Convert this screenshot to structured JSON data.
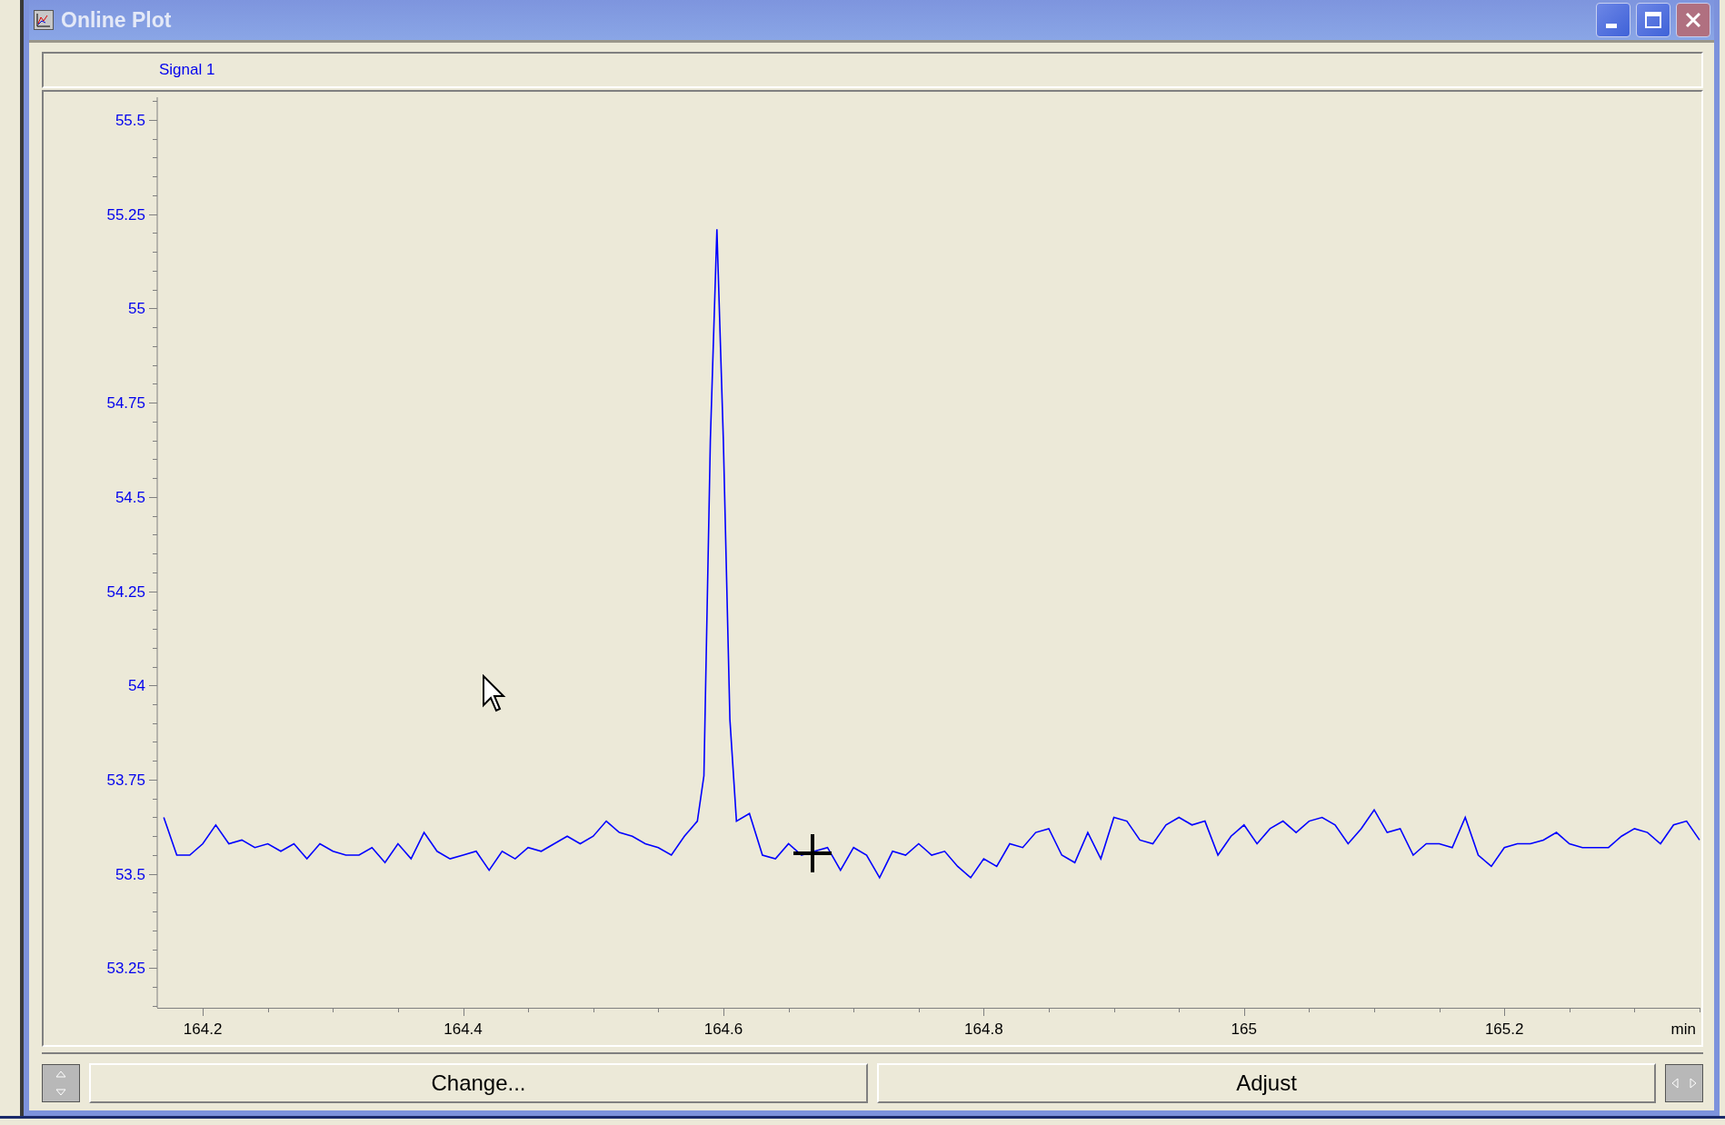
{
  "window": {
    "title": "Online Plot"
  },
  "plot": {
    "chart_data": {
      "type": "line",
      "xlabel": "min",
      "xlim": [
        164.165,
        165.35
      ],
      "ylim": [
        53.145,
        55.56
      ],
      "xticks": [
        164.2,
        164.4,
        164.6,
        164.8,
        165,
        165.2
      ],
      "yticks": [
        53.25,
        53.5,
        53.75,
        54,
        54.25,
        54.5,
        54.75,
        55,
        55.25,
        55.5
      ],
      "x": [
        164.17,
        164.18,
        164.19,
        164.2,
        164.21,
        164.22,
        164.23,
        164.24,
        164.25,
        164.26,
        164.27,
        164.28,
        164.29,
        164.3,
        164.31,
        164.32,
        164.33,
        164.34,
        164.35,
        164.36,
        164.37,
        164.38,
        164.39,
        164.4,
        164.41,
        164.42,
        164.43,
        164.44,
        164.45,
        164.46,
        164.47,
        164.48,
        164.49,
        164.5,
        164.51,
        164.52,
        164.53,
        164.54,
        164.55,
        164.56,
        164.57,
        164.58,
        164.585,
        164.59,
        164.595,
        164.6,
        164.605,
        164.61,
        164.62,
        164.63,
        164.64,
        164.65,
        164.66,
        164.67,
        164.68,
        164.69,
        164.7,
        164.71,
        164.72,
        164.73,
        164.74,
        164.75,
        164.76,
        164.77,
        164.78,
        164.79,
        164.8,
        164.81,
        164.82,
        164.83,
        164.84,
        164.85,
        164.86,
        164.87,
        164.88,
        164.89,
        164.9,
        164.91,
        164.92,
        164.93,
        164.94,
        164.95,
        164.96,
        164.97,
        164.98,
        164.99,
        165,
        165.01,
        165.02,
        165.03,
        165.04,
        165.05,
        165.06,
        165.07,
        165.08,
        165.09,
        165.1,
        165.11,
        165.12,
        165.13,
        165.14,
        165.15,
        165.16,
        165.17,
        165.18,
        165.19,
        165.2,
        165.21,
        165.22,
        165.23,
        165.24,
        165.25,
        165.26,
        165.27,
        165.28,
        165.29,
        165.3,
        165.31,
        165.32,
        165.33,
        165.34,
        165.35
      ],
      "series": [
        {
          "name": "Signal 1",
          "color": "#0000ff",
          "values": [
            53.65,
            53.55,
            53.55,
            53.58,
            53.63,
            53.58,
            53.59,
            53.57,
            53.58,
            53.56,
            53.58,
            53.54,
            53.58,
            53.56,
            53.55,
            53.55,
            53.57,
            53.53,
            53.58,
            53.54,
            53.61,
            53.56,
            53.54,
            53.55,
            53.56,
            53.51,
            53.56,
            53.54,
            53.57,
            53.56,
            53.58,
            53.6,
            53.58,
            53.6,
            53.64,
            53.61,
            53.6,
            53.58,
            53.57,
            53.55,
            53.6,
            53.64,
            53.76,
            54.65,
            55.21,
            54.65,
            53.91,
            53.64,
            53.66,
            53.55,
            53.54,
            53.58,
            53.55,
            53.56,
            53.57,
            53.51,
            53.57,
            53.55,
            53.49,
            53.56,
            53.55,
            53.58,
            53.55,
            53.56,
            53.52,
            53.49,
            53.54,
            53.52,
            53.58,
            53.57,
            53.61,
            53.62,
            53.55,
            53.53,
            53.61,
            53.54,
            53.65,
            53.64,
            53.59,
            53.58,
            53.63,
            53.65,
            53.63,
            53.64,
            53.55,
            53.6,
            53.63,
            53.58,
            53.62,
            53.64,
            53.61,
            53.64,
            53.65,
            53.63,
            53.58,
            53.62,
            53.67,
            53.61,
            53.62,
            53.55,
            53.58,
            53.58,
            53.57,
            53.65,
            53.55,
            53.52,
            53.57,
            53.58,
            53.58,
            53.59,
            53.61,
            53.58,
            53.57,
            53.57,
            53.57,
            53.6,
            53.62,
            53.61,
            53.58,
            53.63,
            53.64,
            53.59
          ]
        }
      ]
    }
  },
  "buttons": [
    "Change...",
    "Adjust"
  ]
}
